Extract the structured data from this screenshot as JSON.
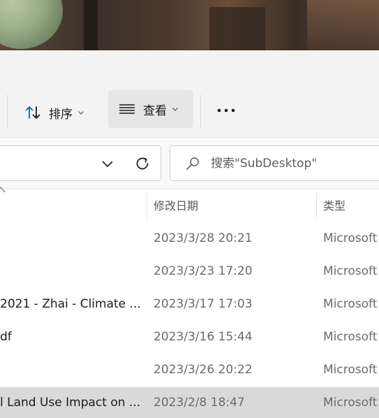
{
  "toolbar": {
    "sort_label": "排序",
    "view_label": "查看",
    "more_label": "•••"
  },
  "search": {
    "placeholder": "搜索\"SubDesktop\""
  },
  "columns": {
    "date": "修改日期",
    "type": "类型"
  },
  "rows": [
    {
      "name": "",
      "date": "2023/3/28 20:21",
      "type": "Microsoft"
    },
    {
      "name": "",
      "date": "2023/3/23 17:20",
      "type": "Microsoft"
    },
    {
      "name": "2021 - Zhai - Climate ...",
      "date": "2023/3/17 17:03",
      "type": "Microsoft"
    },
    {
      "name": "df",
      "date": "2023/3/16 15:44",
      "type": "Microsoft"
    },
    {
      "name": "",
      "date": "2023/3/26 20:22",
      "type": "Microsoft"
    },
    {
      "name": "l Land Use Impact on ...",
      "date": "2023/2/8 18:47",
      "type": "Microsoft"
    }
  ],
  "colors": {
    "accent": "#0067c0",
    "selected_row": "#d9d9d9"
  }
}
